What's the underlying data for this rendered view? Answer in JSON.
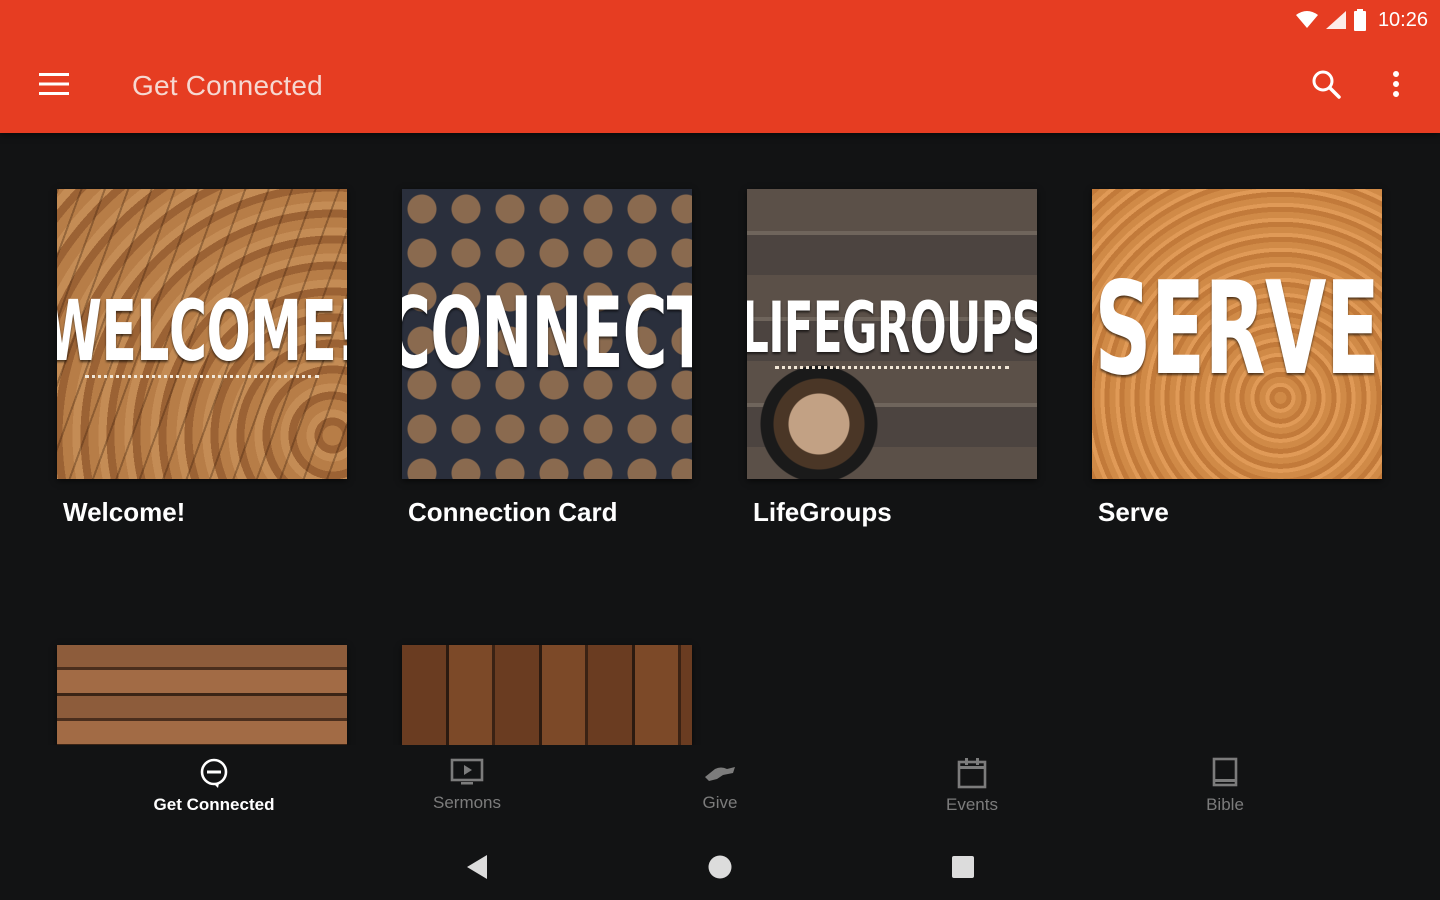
{
  "status_bar": {
    "time": "10:26"
  },
  "app_bar": {
    "title": "Get Connected"
  },
  "cards": [
    {
      "image_text": "WELCOME!",
      "caption": "Welcome!"
    },
    {
      "image_text": "CONNECT",
      "caption": "Connection Card"
    },
    {
      "image_text": "LIFEGROUPS",
      "caption": "LifeGroups"
    },
    {
      "image_text": "SERVE",
      "caption": "Serve"
    }
  ],
  "bottom_nav": [
    {
      "label": "Get Connected",
      "icon": "chat-bubble-icon",
      "active": true
    },
    {
      "label": "Sermons",
      "icon": "monitor-play-icon",
      "active": false
    },
    {
      "label": "Give",
      "icon": "hand-give-icon",
      "active": false
    },
    {
      "label": "Events",
      "icon": "calendar-icon",
      "active": false
    },
    {
      "label": "Bible",
      "icon": "book-icon",
      "active": false
    }
  ],
  "colors": {
    "app_bar": "#e63d22",
    "background": "#121314",
    "inactive_nav": "#7c7c7c"
  }
}
